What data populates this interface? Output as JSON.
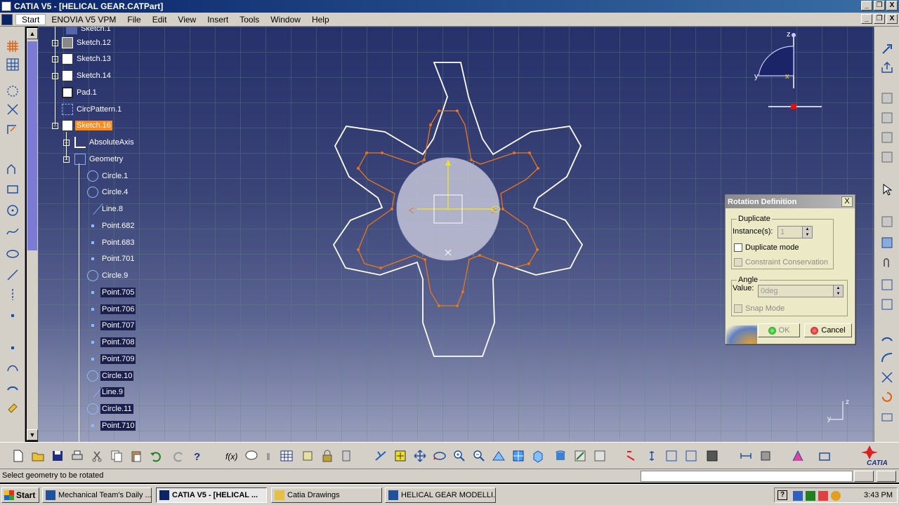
{
  "window": {
    "title": "CATIA V5 - [HELICAL GEAR.CATPart]",
    "min": "_",
    "restore": "❐",
    "close": "X"
  },
  "menu": {
    "items": [
      "Start",
      "ENOVIA V5 VPM",
      "File",
      "Edit",
      "View",
      "Insert",
      "Tools",
      "Window",
      "Help"
    ]
  },
  "tree": {
    "items": [
      {
        "label": "Sketch.1",
        "indent": 0
      },
      {
        "label": "Sketch.12",
        "indent": 0
      },
      {
        "label": "Sketch.13",
        "indent": 0
      },
      {
        "label": "Sketch.14",
        "indent": 0
      },
      {
        "label": "Pad.1",
        "indent": 0
      },
      {
        "label": "CircPattern.1",
        "indent": 0
      },
      {
        "label": "Sketch.16",
        "indent": 0
      },
      {
        "label": "AbsoluteAxis",
        "indent": 1
      },
      {
        "label": "Geometry",
        "indent": 1
      },
      {
        "label": "Circle.1",
        "indent": 2
      },
      {
        "label": "Circle.4",
        "indent": 2
      },
      {
        "label": "Line.8",
        "indent": 2
      },
      {
        "label": "Point.682",
        "indent": 2
      },
      {
        "label": "Point.683",
        "indent": 2
      },
      {
        "label": "Point.701",
        "indent": 2
      },
      {
        "label": "Circle.9",
        "indent": 2
      },
      {
        "label": "Point.705",
        "indent": 2
      },
      {
        "label": "Point.706",
        "indent": 2
      },
      {
        "label": "Point.707",
        "indent": 2
      },
      {
        "label": "Point.708",
        "indent": 2
      },
      {
        "label": "Point.709",
        "indent": 2
      },
      {
        "label": "Circle.10",
        "indent": 2
      },
      {
        "label": "Line.9",
        "indent": 2
      },
      {
        "label": "Circle.11",
        "indent": 2
      },
      {
        "label": "Point.710",
        "indent": 2
      }
    ]
  },
  "compass": {
    "z": "z",
    "y": "y",
    "x": "x"
  },
  "axis_corner": {
    "z": "z",
    "y": "y"
  },
  "dialog": {
    "title": "Rotation Definition",
    "close": "X",
    "duplicate_group": "Duplicate",
    "instances_label": "Instance(s):",
    "instances_value": "1",
    "duplicate_mode": "Duplicate mode",
    "constraint_conservation": "Constraint Conservation",
    "angle_group": "Angle",
    "value_label": "Value:",
    "value": "0deg",
    "snap_mode": "Snap Mode",
    "ok": "OK",
    "cancel": "Cancel"
  },
  "status": {
    "message": "Select geometry to be rotated"
  },
  "taskbar": {
    "start": "Start",
    "tasks": [
      {
        "label": "Mechanical Team's Daily ..."
      },
      {
        "label": "CATIA V5 - [HELICAL ...",
        "active": true
      },
      {
        "label": "Catia Drawings"
      },
      {
        "label": "HELICAL GEAR MODELLI..."
      }
    ],
    "clock": "3:43 PM"
  },
  "colors": {
    "viewport_top": "#26306a",
    "selection_orange": "#ff8c1a",
    "profile_white": "#ffffff",
    "sketch_orange": "#e8761c"
  }
}
